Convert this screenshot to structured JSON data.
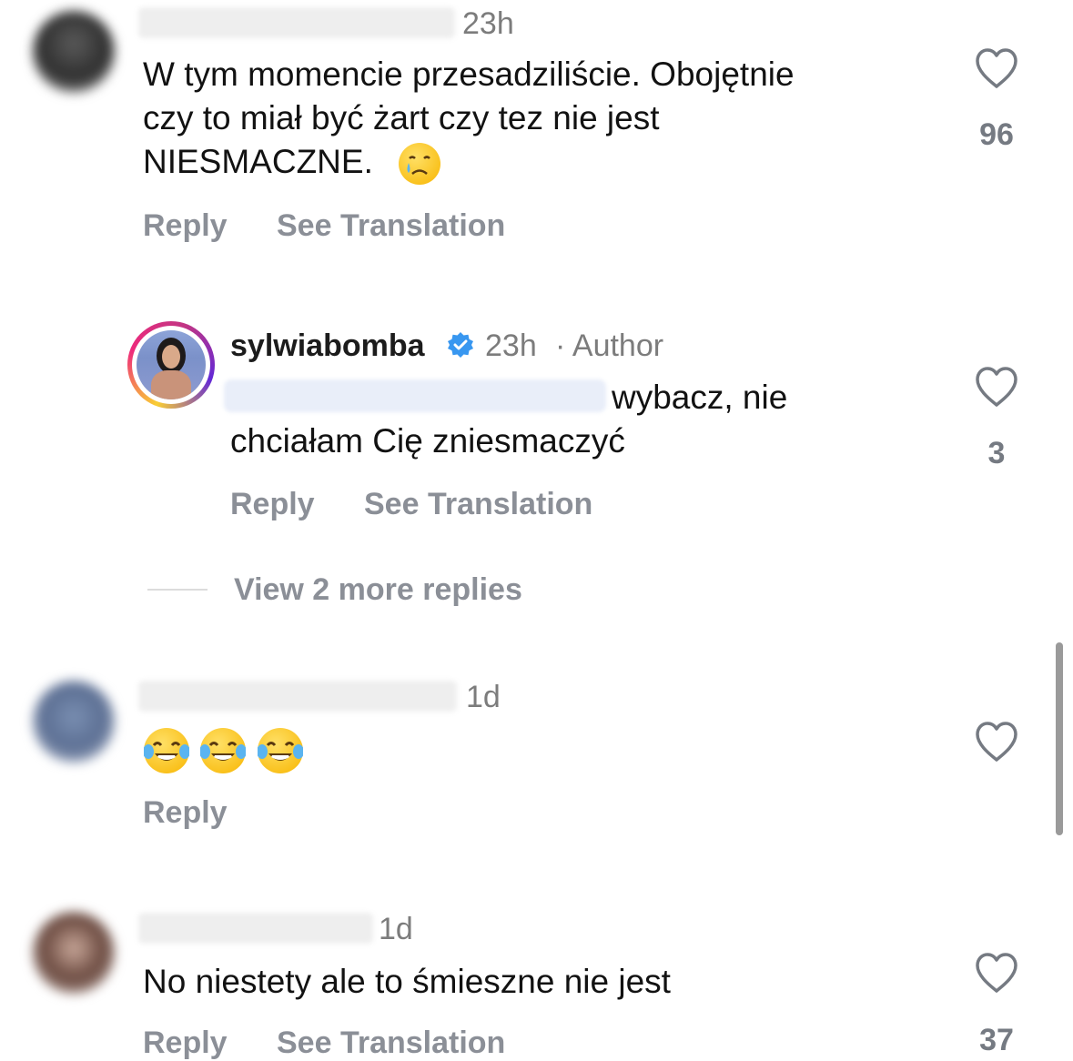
{
  "comments": [
    {
      "time": "23h",
      "text_lines": [
        "W tym momencie przesadziliście. Obojętnie",
        "czy to miał być  żart czy tez nie jest",
        "NIESMACZNE."
      ],
      "reply_label": "Reply",
      "translate_label": "See Translation",
      "like_count": "96"
    },
    {
      "username": "sylwiabomba",
      "time": "23h",
      "author_tag": "· Author",
      "text_lines": [
        "wybacz, nie",
        "chciałam Cię zniesmaczyć"
      ],
      "reply_label": "Reply",
      "translate_label": "See Translation",
      "like_count": "3"
    },
    {
      "time": "1d",
      "reply_label": "Reply"
    },
    {
      "time": "1d",
      "text_lines": [
        "No niestety ale to śmieszne nie jest"
      ],
      "reply_label": "Reply",
      "translate_label": "See Translation",
      "like_count": "37"
    }
  ],
  "view_more_replies": "View 2 more replies",
  "icons": {
    "like": "heart-outline-icon",
    "verified": "verified-badge-icon",
    "crying": "crying-face-emoji",
    "laughing": "tears-of-joy-emoji"
  },
  "colors": {
    "verified_blue": "#3897f0",
    "secondary_text": "#8b8f97",
    "story_ring_start": "#f9ce34",
    "story_ring_end": "#c13584"
  }
}
